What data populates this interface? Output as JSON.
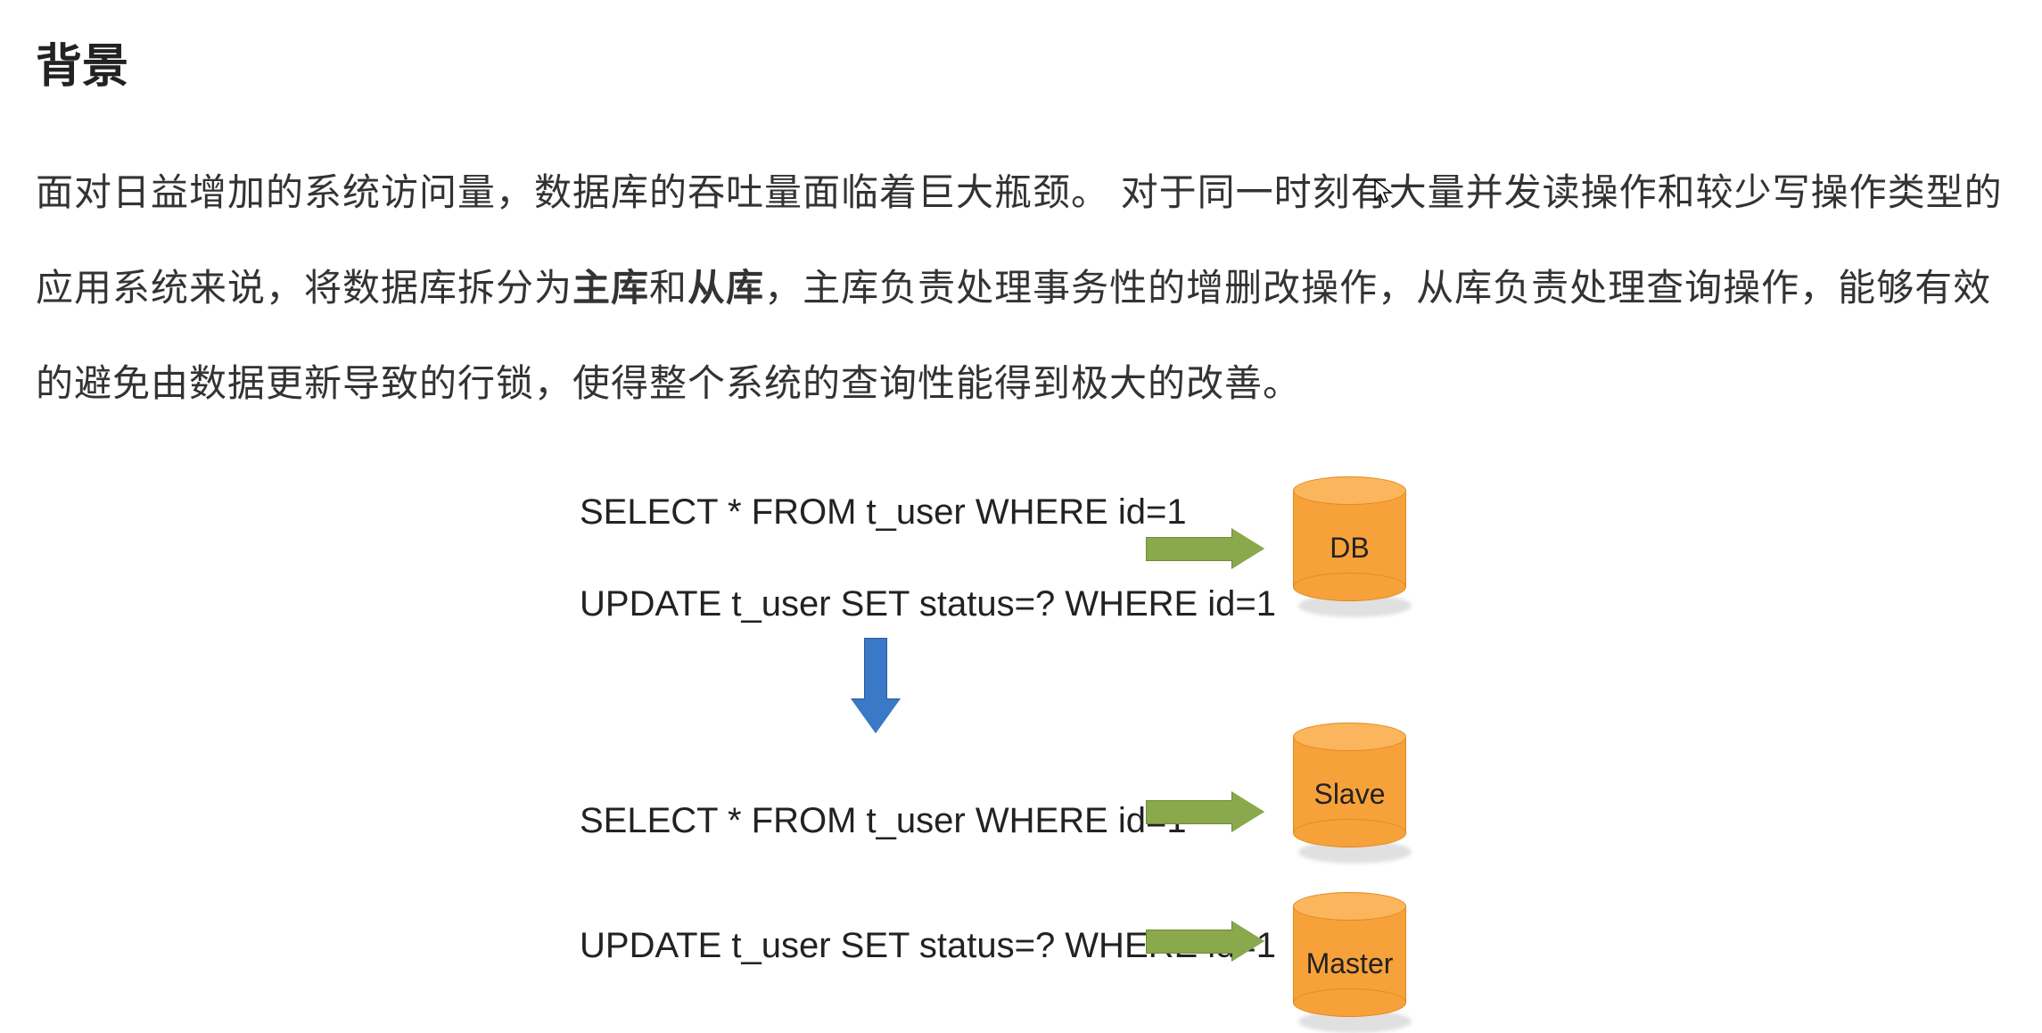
{
  "heading": "背景",
  "paragraph": {
    "pre": "面对日益增加的系统访问量，数据库的吞吐量面临着巨大瓶颈。 对于同一时刻有大量并发读操作和较少写操作类型的应用系统来说，将数据库拆分为",
    "bold1": "主库",
    "mid1": "和",
    "bold2": "从库",
    "post": "，主库负责处理事务性的增删改操作，从库负责处理查询操作，能够有效的避免由数据更新导致的行锁，使得整个系统的查询性能得到极大的改善。"
  },
  "diagram": {
    "sql1": "SELECT * FROM t_user WHERE id=1",
    "sql2": "UPDATE t_user SET status=? WHERE id=1",
    "sql3": "SELECT * FROM t_user WHERE id=1",
    "sql4": "UPDATE t_user SET status=? WHERE id=1",
    "db1_label": "DB",
    "db2_label": "Slave",
    "db3_label": "Master"
  }
}
